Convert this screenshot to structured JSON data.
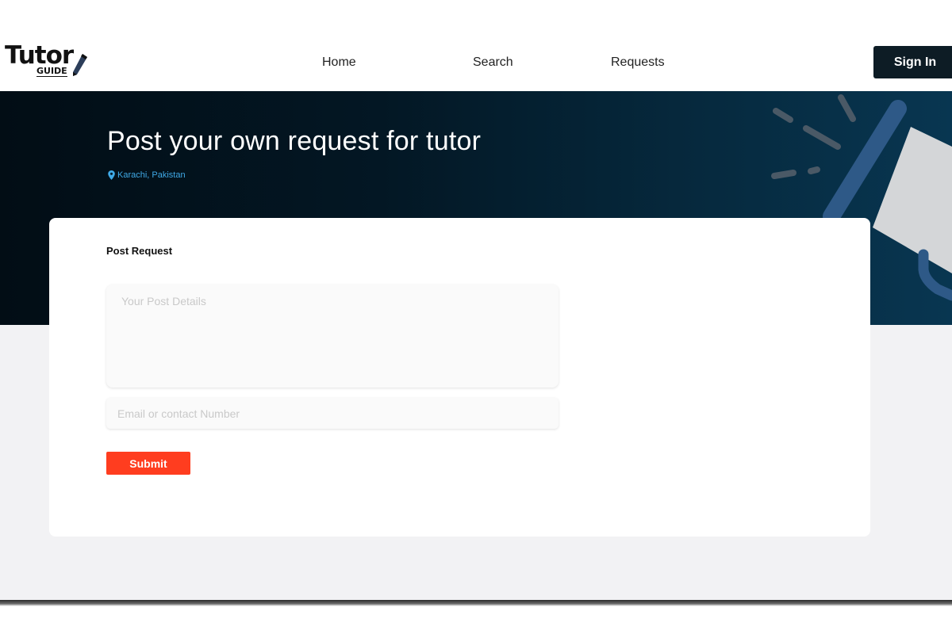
{
  "logo": {
    "word": "Tutor",
    "sub": "GUIDE"
  },
  "nav": {
    "home": "Home",
    "search": "Search",
    "requests": "Requests"
  },
  "header": {
    "signin_label": "Sign In"
  },
  "hero": {
    "title": "Post your own request for tutor",
    "location": "Karachi, Pakistan"
  },
  "form": {
    "title": "Post Request",
    "details_placeholder": "Your Post Details",
    "details_value": "",
    "contact_placeholder": "Email or contact Number",
    "contact_value": "",
    "submit_label": "Submit"
  },
  "colors": {
    "brand_dark": "#0d1c25",
    "accent": "#ff3d1f",
    "location": "#3fa9e6"
  },
  "icons": {
    "location": "map-pin-icon",
    "logo_pen": "pen-icon",
    "hero": "megaphone-illustration"
  }
}
